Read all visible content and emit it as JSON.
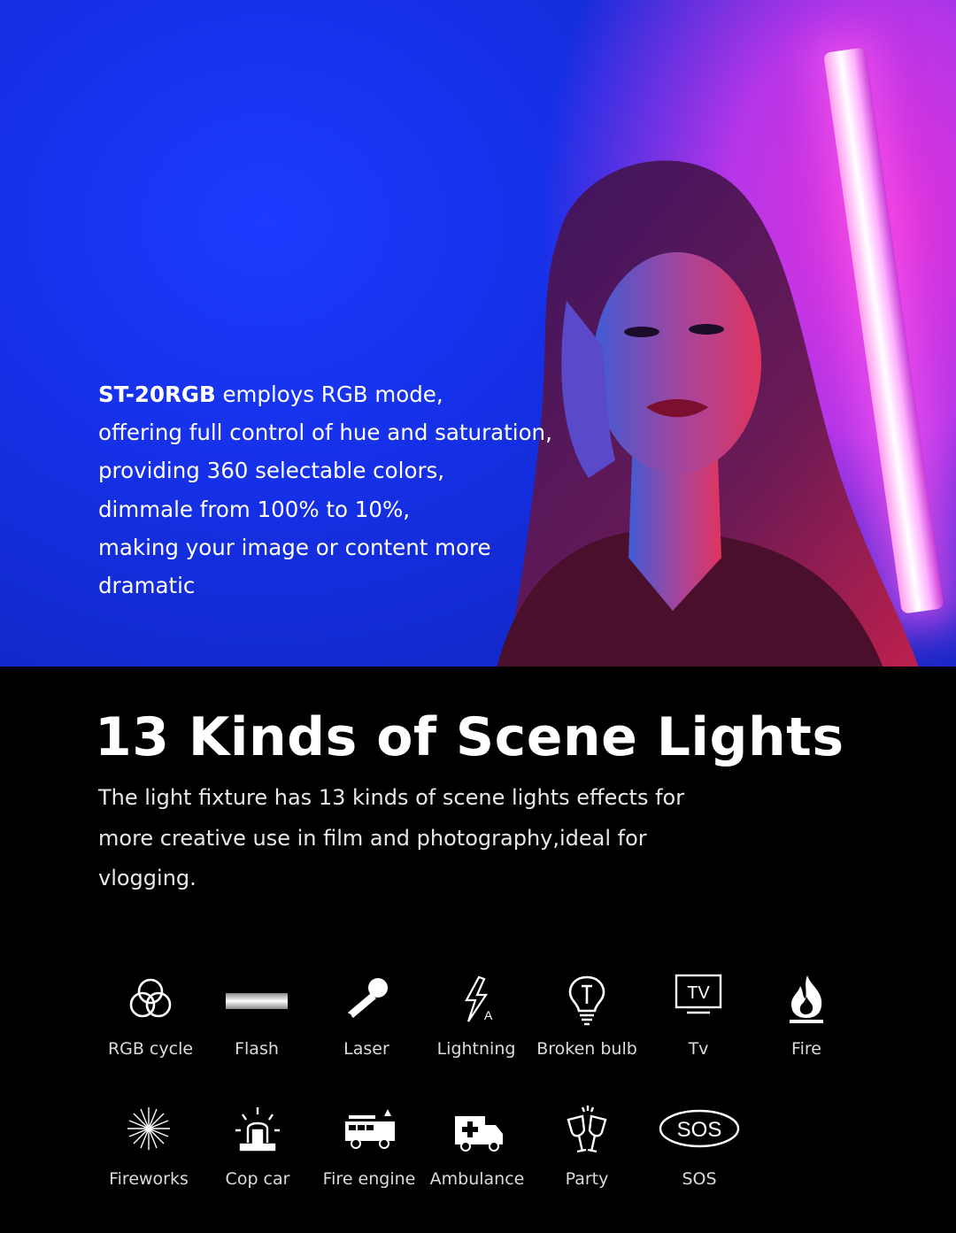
{
  "hero": {
    "model": "ST-20RGB",
    "line1_rest": " employs RGB mode,",
    "line2": "offering full control of hue and saturation,",
    "line3": "providing 360 selectable colors,",
    "line4": "dimmale from 100% to 10%,",
    "line5": "making your image or content more",
    "line6": "dramatic"
  },
  "section": {
    "title": "13 Kinds of Scene Lights",
    "desc_line1": "The light fixture has 13 kinds of scene lights effects for",
    "desc_line2": "more creative use in film and photography,ideal for",
    "desc_line3": "vlogging."
  },
  "effects": [
    {
      "label": "RGB cycle",
      "icon": "rgb-cycle-icon"
    },
    {
      "label": "Flash",
      "icon": "flash-icon"
    },
    {
      "label": "Laser",
      "icon": "laser-icon"
    },
    {
      "label": "Lightning",
      "icon": "lightning-icon"
    },
    {
      "label": "Broken bulb",
      "icon": "broken-bulb-icon"
    },
    {
      "label": "Tv",
      "icon": "tv-icon",
      "icon_text": "TV"
    },
    {
      "label": "Fire",
      "icon": "fire-icon"
    },
    {
      "label": "Fireworks",
      "icon": "fireworks-icon"
    },
    {
      "label": "Cop car",
      "icon": "cop-car-icon"
    },
    {
      "label": "Fire engine",
      "icon": "fire-engine-icon"
    },
    {
      "label": "Ambulance",
      "icon": "ambulance-icon"
    },
    {
      "label": "Party",
      "icon": "party-icon"
    },
    {
      "label": "SOS",
      "icon": "sos-icon",
      "icon_text": "SOS"
    }
  ]
}
